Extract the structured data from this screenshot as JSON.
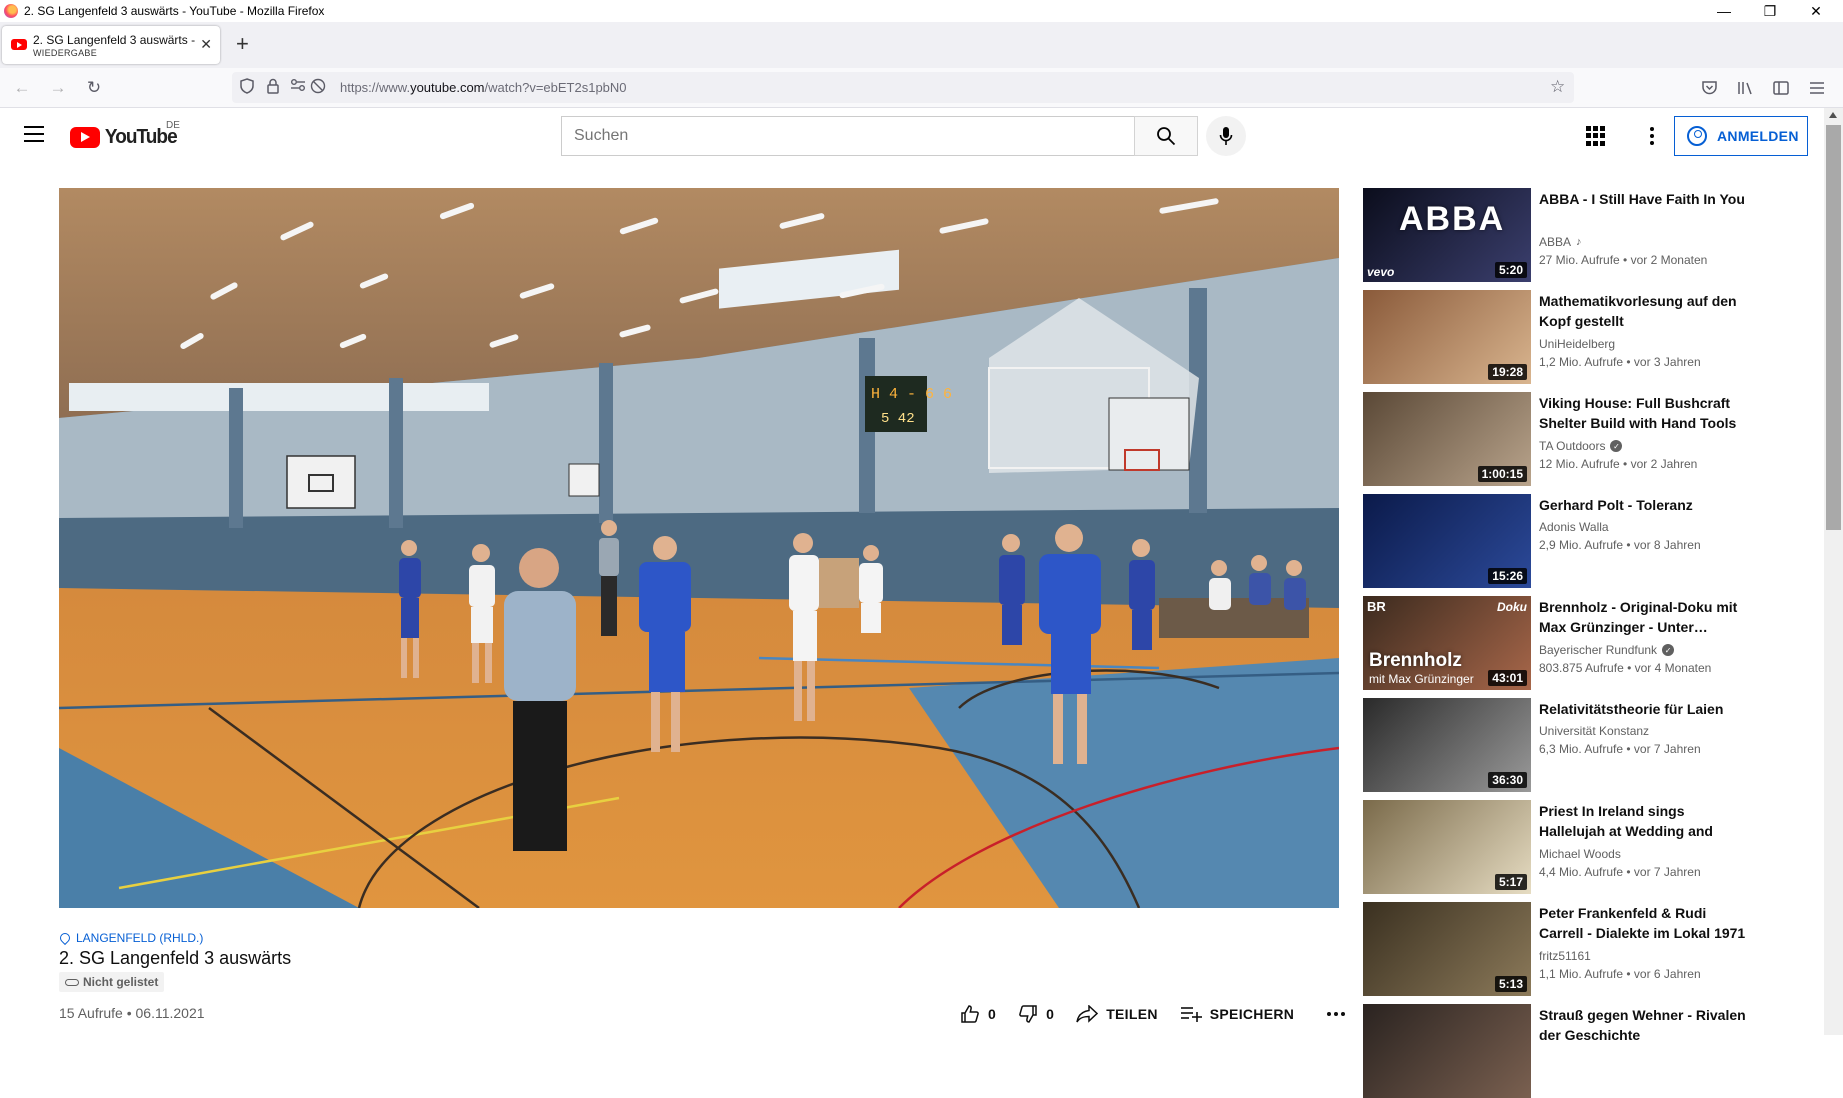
{
  "window": {
    "title": "2. SG Langenfeld 3 auswärts - YouTube - Mozilla Firefox",
    "controls": {
      "minimize": "—",
      "restore": "❐",
      "close": "✕"
    }
  },
  "tab": {
    "title": "2. SG Langenfeld 3 auswärts - YouTube",
    "status": "WIEDERGABE",
    "new_tab_label": "+"
  },
  "navbar": {
    "url_prefix": "https://www.",
    "url_domain": "youtube.com",
    "url_path": "/watch?v=ebET2s1pbN0"
  },
  "masthead": {
    "logo_text": "YouTube",
    "region": "DE",
    "search_placeholder": "Suchen",
    "signin_label": "ANMELDEN"
  },
  "player": {
    "scoreboard_top": "H 4 - 6 6",
    "scoreboard_bottom": "5 42"
  },
  "video": {
    "location": "LANGENFELD (RHLD.)",
    "title": "2. SG Langenfeld 3 auswärts",
    "privacy": "Nicht gelistet",
    "views_date": "15 Aufrufe • 06.11.2021",
    "likes": "0",
    "dislikes": "0",
    "share_label": "TEILEN",
    "save_label": "SPEICHERN"
  },
  "related": [
    {
      "title": "ABBA - I Still Have Faith In You",
      "channel": "ABBA",
      "badge": "music",
      "meta": "27 Mio. Aufrufe • vor 2 Monaten",
      "duration": "5:20",
      "thumb_text": "ABBA",
      "thumb_tag": "vevo",
      "colors": [
        "#0b0d1c",
        "#3b3f6e"
      ]
    },
    {
      "title": "Mathematikvorlesung auf den Kopf gestellt",
      "channel": "UniHeidelberg",
      "badge": "",
      "meta": "1,2 Mio. Aufrufe • vor 3 Jahren",
      "duration": "19:28",
      "thumb_text": "",
      "thumb_tag": "",
      "colors": [
        "#8a5a3a",
        "#d9b58f"
      ]
    },
    {
      "title": "Viking House: Full Bushcraft Shelter Build with Hand Tools |…",
      "channel": "TA Outdoors",
      "badge": "verified",
      "meta": "12 Mio. Aufrufe • vor 2 Jahren",
      "duration": "1:00:15",
      "thumb_text": "",
      "thumb_tag": "",
      "colors": [
        "#5a4836",
        "#b9a48c"
      ]
    },
    {
      "title": "Gerhard Polt - Toleranz",
      "channel": "Adonis Walla",
      "badge": "",
      "meta": "2,9 Mio. Aufrufe • vor 8 Jahren",
      "duration": "15:26",
      "thumb_text": "",
      "thumb_tag": "",
      "colors": [
        "#0b1a4a",
        "#2c4a9a"
      ]
    },
    {
      "title": "Brennholz - Original-Doku mit Max Grünzinger - Unter…",
      "channel": "Bayerischer Rundfunk",
      "badge": "verified",
      "meta": "803.875 Aufrufe • vor 4 Monaten",
      "duration": "43:01",
      "thumb_text": "Brennholz",
      "thumb_sub": "mit Max Grünzinger",
      "thumb_tag": "Doku",
      "thumb_logo": "BR",
      "colors": [
        "#3b2a1e",
        "#a8674a"
      ]
    },
    {
      "title": "Relativitätstheorie für Laien",
      "channel": "Universität Konstanz",
      "badge": "",
      "meta": "6,3 Mio. Aufrufe • vor 7 Jahren",
      "duration": "36:30",
      "thumb_text": "",
      "thumb_tag": "",
      "colors": [
        "#2a2a2a",
        "#9a9a9a"
      ]
    },
    {
      "title": "Priest In Ireland sings Hallelujah at Wedding and shocks…",
      "channel": "Michael Woods",
      "badge": "",
      "meta": "4,4 Mio. Aufrufe • vor 7 Jahren",
      "duration": "5:17",
      "thumb_text": "",
      "thumb_tag": "",
      "colors": [
        "#7a6a4a",
        "#e6dcc2"
      ]
    },
    {
      "title": "Peter Frankenfeld & Rudi Carrell - Dialekte im Lokal 1971",
      "channel": "fritz51161",
      "badge": "",
      "meta": "1,1 Mio. Aufrufe • vor 6 Jahren",
      "duration": "5:13",
      "thumb_text": "",
      "thumb_tag": "",
      "colors": [
        "#3a3020",
        "#8c7a5a"
      ]
    },
    {
      "title": "Strauß gegen Wehner - Rivalen der Geschichte",
      "channel": "",
      "badge": "",
      "meta": "",
      "duration": "",
      "thumb_text": "",
      "thumb_tag": "",
      "colors": [
        "#2a2320",
        "#7a6050"
      ]
    }
  ]
}
